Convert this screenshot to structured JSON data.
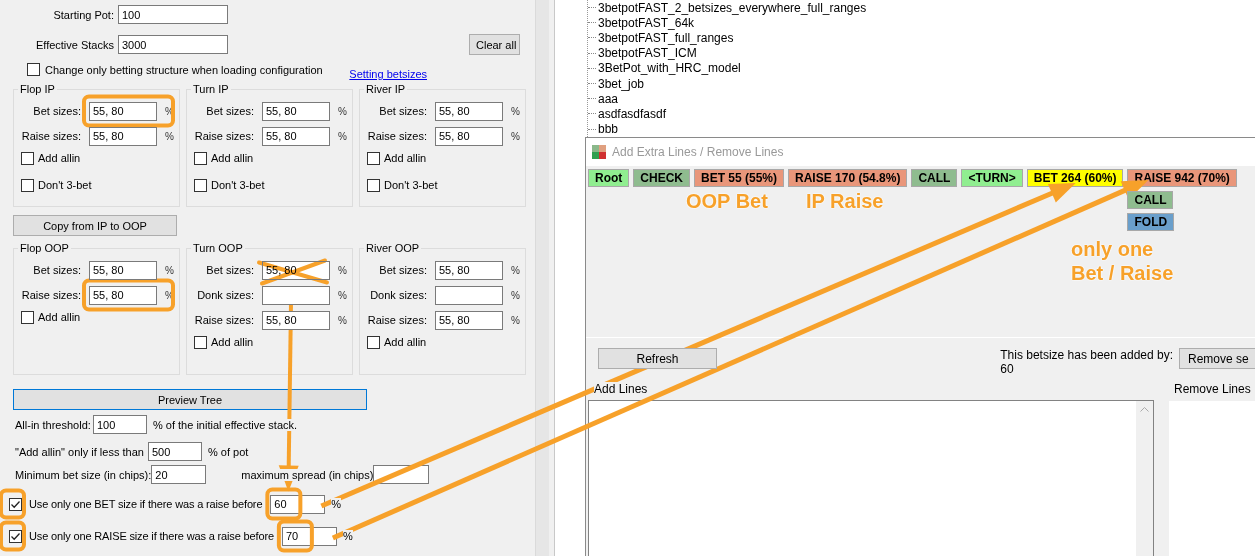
{
  "setup": {
    "starting_pot": {
      "label": "Starting Pot:",
      "value": "100"
    },
    "effective_stacks": {
      "label": "Effective Stacks",
      "value": "3000"
    },
    "clear_button": "Clear all",
    "load_option": {
      "label": "Change only betting structure when loading configuration",
      "checked": false
    },
    "link": "Setting betsizes"
  },
  "ip_groups": [
    {
      "title": "Flop IP",
      "fields": [
        {
          "label": "Bet sizes:",
          "value": "55, 80",
          "unit": "%"
        },
        {
          "label": "Raise sizes:",
          "value": "55, 80",
          "unit": "%"
        }
      ],
      "checkboxes": [
        {
          "label": "Add allin",
          "checked": false
        },
        {
          "label": "Don't 3-bet",
          "checked": false
        }
      ]
    },
    {
      "title": "Turn IP",
      "fields": [
        {
          "label": "Bet sizes:",
          "value": "55, 80",
          "unit": "%"
        },
        {
          "label": "Raise sizes:",
          "value": "55, 80",
          "unit": "%"
        }
      ],
      "checkboxes": [
        {
          "label": "Add allin",
          "checked": false
        },
        {
          "label": "Don't 3-bet",
          "checked": false
        }
      ]
    },
    {
      "title": "River IP",
      "fields": [
        {
          "label": "Bet sizes:",
          "value": "55, 80",
          "unit": "%"
        },
        {
          "label": "Raise sizes:",
          "value": "55, 80",
          "unit": "%"
        }
      ],
      "checkboxes": [
        {
          "label": "Add allin",
          "checked": false
        },
        {
          "label": "Don't 3-bet",
          "checked": false
        }
      ]
    }
  ],
  "copy_button": "Copy from IP to OOP",
  "oop_groups": [
    {
      "title": "Flop OOP",
      "fields": [
        {
          "label": "Bet sizes:",
          "value": "55, 80",
          "unit": "%"
        },
        {
          "label": "Raise sizes:",
          "value": "55, 80",
          "unit": "%"
        }
      ],
      "checkboxes": [
        {
          "label": "Add allin",
          "checked": false
        }
      ]
    },
    {
      "title": "Turn OOP",
      "fields": [
        {
          "label": "Bet sizes:",
          "value": "55, 80",
          "unit": "%"
        },
        {
          "label": "Donk sizes:",
          "unit": "%"
        },
        {
          "label": "Raise sizes:",
          "value": "55, 80",
          "unit": "%"
        }
      ],
      "checkboxes": [
        {
          "label": "Add allin",
          "checked": false
        }
      ]
    },
    {
      "title": "River OOP",
      "fields": [
        {
          "label": "Bet sizes:",
          "value": "55, 80",
          "unit": "%"
        },
        {
          "label": "Donk sizes:",
          "unit": "%"
        },
        {
          "label": "Raise sizes:",
          "value": "55, 80",
          "unit": "%"
        }
      ],
      "checkboxes": [
        {
          "label": "Add allin",
          "checked": false
        }
      ]
    }
  ],
  "preview_button": "Preview Tree",
  "thresholds": [
    {
      "label": "All-in threshold:",
      "value": "100",
      "suffix": "% of the initial effective stack."
    },
    {
      "label": "\"Add allin\" only if less than",
      "value": "500",
      "suffix": "% of pot"
    }
  ],
  "min_bet": {
    "label": "Minimum bet size (in chips):",
    "value": "20",
    "spread_label": "maximum spread (in chips)"
  },
  "single_size_options": [
    {
      "label": "Use only one BET size if there was a raise before",
      "checked": true,
      "value": "60",
      "unit": "%"
    },
    {
      "label": "Use only one RAISE size if there was a raise before",
      "checked": true,
      "value": "70",
      "unit": "%"
    }
  ],
  "tree_items": [
    "3betpotFAST_2_betsizes_everywhere_full_ranges",
    "3betpotFAST_64k",
    "3betpotFAST_full_ranges",
    "3betpotFAST_ICM",
    "3BetPot_with_HRC_model",
    "3bet_job",
    "aaa",
    "asdfasdfasdf",
    "bbb"
  ],
  "dialog": {
    "title": "Add Extra Lines / Remove Lines",
    "line_nodes": [
      {
        "label": "Root",
        "color": "#90ee90"
      },
      {
        "label": "CHECK",
        "color": "#8fbc8f"
      },
      {
        "label": "BET 55 (55%)",
        "color": "#e9967a"
      },
      {
        "label": "RAISE 170 (54.8%)",
        "color": "#e9967a"
      },
      {
        "label": "CALL",
        "color": "#8fbc8f"
      },
      {
        "label": "<TURN>",
        "color": "#90ee90"
      },
      {
        "label": "BET 264 (60%)",
        "color": "#ffff00"
      },
      {
        "label": "RAISE 942 (70%)",
        "color": "#e9967a",
        "children": [
          {
            "label": "CALL",
            "color": "#8fbc8f"
          },
          {
            "label": "FOLD",
            "color": "#6a9fcb"
          }
        ]
      }
    ],
    "refresh_button": "Refresh",
    "added_by_label": "This betsize has been added by:",
    "added_by_value": "60",
    "remove_button": "Remove se",
    "add_lines_title": "Add Lines",
    "remove_lines_title": "Remove Lines"
  },
  "annotations": {
    "labels": [
      "OOP Bet",
      "IP Raise",
      "only one",
      "Bet / Raise"
    ]
  }
}
